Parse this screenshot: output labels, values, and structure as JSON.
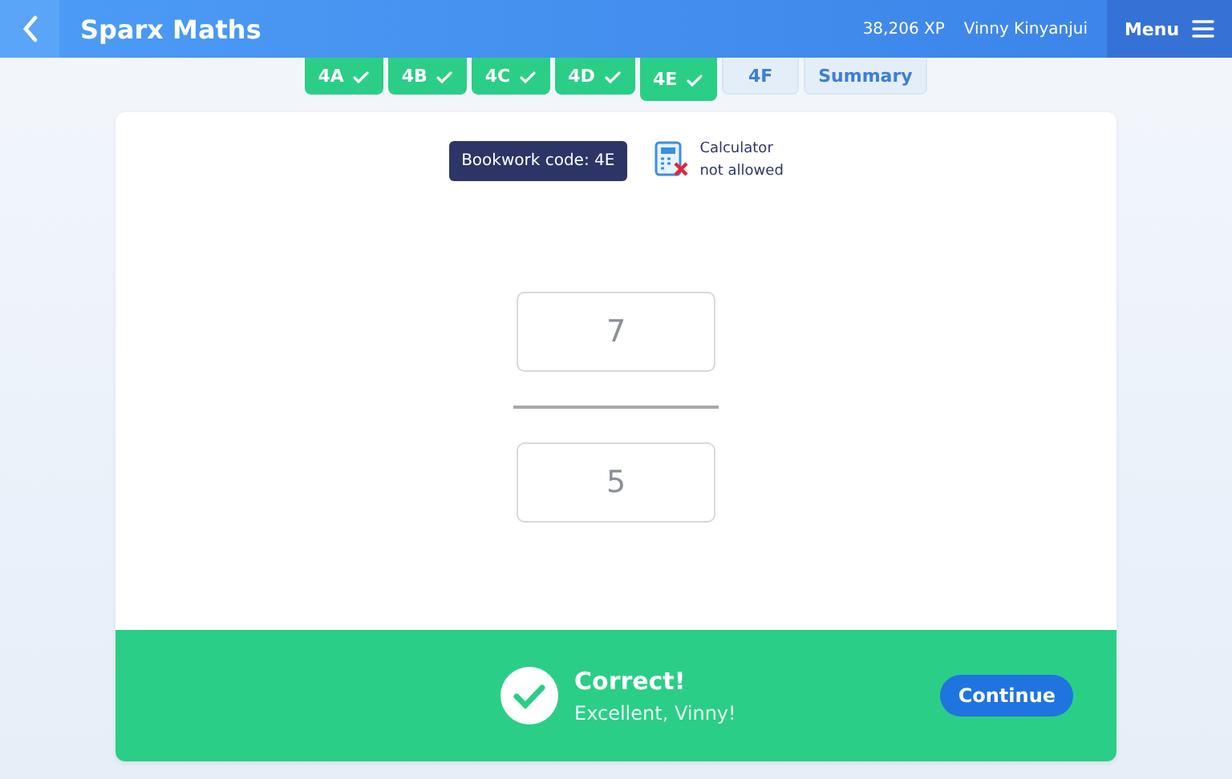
{
  "header": {
    "title": "Sparx Maths",
    "xp": "38,206 XP",
    "user": "Vinny Kinyanjui",
    "menu": "Menu"
  },
  "tabs": [
    {
      "label": "4A",
      "done": true,
      "selected": false
    },
    {
      "label": "4B",
      "done": true,
      "selected": false
    },
    {
      "label": "4C",
      "done": true,
      "selected": false
    },
    {
      "label": "4D",
      "done": true,
      "selected": false
    },
    {
      "label": "4E",
      "done": true,
      "selected": true
    },
    {
      "label": "4F",
      "done": false,
      "selected": false
    },
    {
      "label": "Summary",
      "done": false,
      "selected": false
    }
  ],
  "bookwork": "Bookwork code: 4E",
  "calculator": {
    "line1": "Calculator",
    "line2": "not allowed",
    "allowed": false
  },
  "fraction": {
    "numerator": "7",
    "denominator": "5"
  },
  "result": {
    "correct": true,
    "title": "Correct!",
    "message": "Excellent, Vinny!",
    "button": "Continue"
  }
}
